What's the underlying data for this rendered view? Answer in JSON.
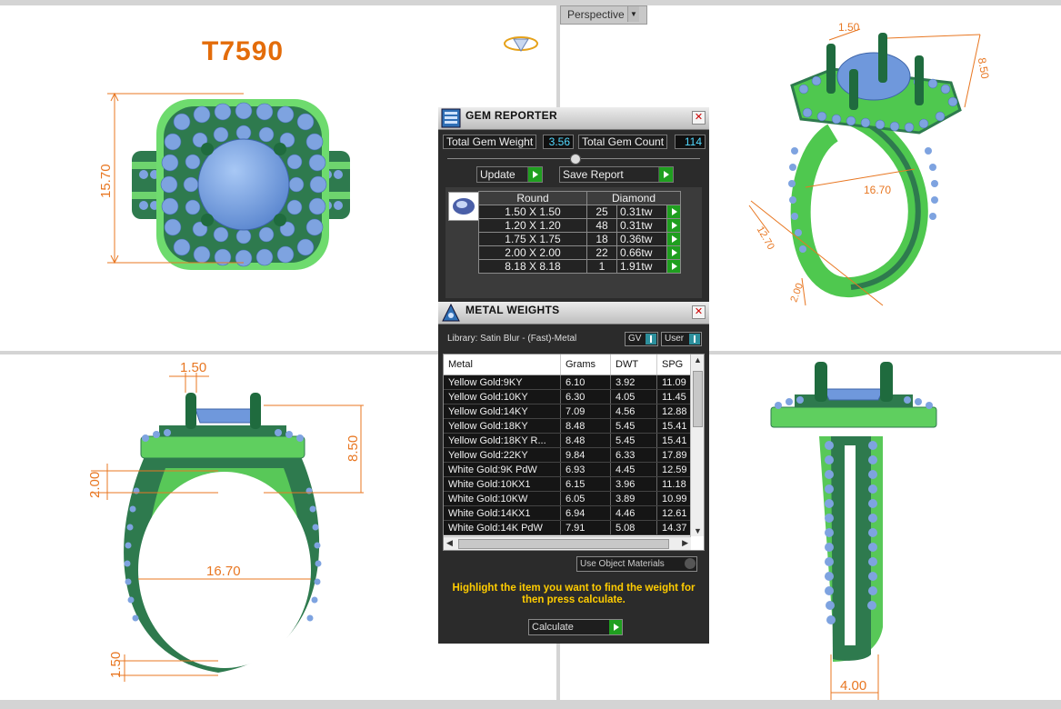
{
  "viewports": {
    "top_left": {
      "model_name": "T7590",
      "dims": [
        "15.70"
      ]
    },
    "top_right": {
      "view_label": "Perspective",
      "dims": [
        "1.50",
        "8.50",
        "16.70",
        "12.70",
        "2.00"
      ]
    },
    "bottom_left": {
      "dims": [
        "1.50",
        "8.50",
        "2.00",
        "16.70",
        "1.50"
      ]
    },
    "bottom_right": {
      "dims": [
        "4.00"
      ]
    }
  },
  "gem_reporter": {
    "title": "GEM REPORTER",
    "total_weight_label": "Total Gem Weight",
    "total_weight_value": "3.56",
    "total_count_label": "Total Gem Count",
    "total_count_value": "114",
    "update_label": "Update",
    "save_report_label": "Save Report",
    "shape": "Round",
    "type": "Diamond",
    "rows": [
      {
        "size": "1.50 X 1.50",
        "count": "25",
        "tw": "0.31tw"
      },
      {
        "size": "1.20 X 1.20",
        "count": "48",
        "tw": "0.31tw"
      },
      {
        "size": "1.75 X 1.75",
        "count": "18",
        "tw": "0.36tw"
      },
      {
        "size": "2.00 X 2.00",
        "count": "22",
        "tw": "0.66tw"
      },
      {
        "size": "8.18 X 8.18",
        "count": "1",
        "tw": "1.91tw"
      }
    ]
  },
  "metal_weights": {
    "title": "METAL WEIGHTS",
    "library": "Library: Satin Blur - (Fast)-Metal",
    "gv_label": "GV",
    "user_label": "User",
    "columns": [
      "Metal",
      "Grams",
      "DWT",
      "SPG"
    ],
    "rows": [
      [
        "Yellow Gold:9KY",
        "6.10",
        "3.92",
        "11.09"
      ],
      [
        "Yellow Gold:10KY",
        "6.30",
        "4.05",
        "11.45"
      ],
      [
        "Yellow Gold:14KY",
        "7.09",
        "4.56",
        "12.88"
      ],
      [
        "Yellow Gold:18KY",
        "8.48",
        "5.45",
        "15.41"
      ],
      [
        "Yellow Gold:18KY R...",
        "8.48",
        "5.45",
        "15.41"
      ],
      [
        "Yellow Gold:22KY",
        "9.84",
        "6.33",
        "17.89"
      ],
      [
        "White Gold:9K PdW",
        "6.93",
        "4.45",
        "12.59"
      ],
      [
        "White Gold:10KX1",
        "6.15",
        "3.96",
        "11.18"
      ],
      [
        "White Gold:10KW",
        "6.05",
        "3.89",
        "10.99"
      ],
      [
        "White Gold:14KX1",
        "6.94",
        "4.46",
        "12.61"
      ],
      [
        "White Gold:14K PdW",
        "7.91",
        "5.08",
        "14.37"
      ]
    ],
    "use_object_materials": "Use Object Materials",
    "hint": "Highlight the item you want to find the weight for then press calculate.",
    "calculate_label": "Calculate"
  }
}
